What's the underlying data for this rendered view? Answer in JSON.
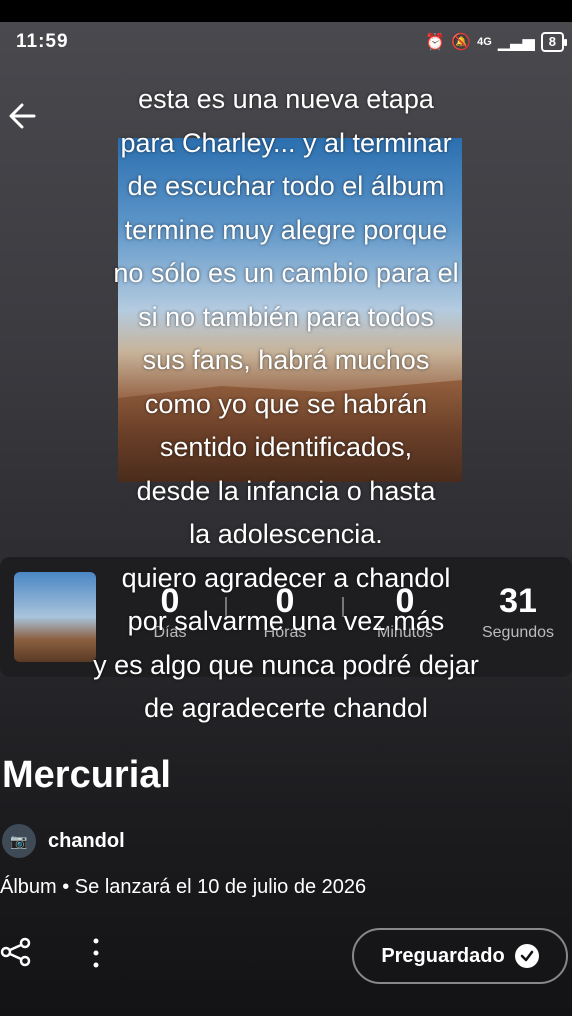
{
  "status": {
    "time": "11:59",
    "network": "4G",
    "battery": "8"
  },
  "overlay_lines": [
    "esta es una nueva etapa",
    "para Charley... y al terminar",
    "de escuchar todo el álbum",
    "termine muy alegre porque",
    "no sólo es un cambio para el",
    "si no también para todos",
    "sus fans, habrá muchos",
    "como yo que se habrán",
    "sentido identificados,",
    "desde la infancia o hasta",
    "la adolescencia.",
    "quiero agradecer a chandol",
    "por salvarme una vez más",
    "y es algo que nunca podré dejar",
    "de agradecerte chandol"
  ],
  "countdown": {
    "days": {
      "value": "0",
      "label": "Días"
    },
    "hours": {
      "value": "0",
      "label": "Horas"
    },
    "minutes": {
      "value": "0",
      "label": "Minutos"
    },
    "seconds": {
      "value": "31",
      "label": "Segundos"
    }
  },
  "album": {
    "title": "Mercurial",
    "artist": "chandol",
    "meta": "Álbum • Se lanzará el 10 de julio de 2026"
  },
  "actions": {
    "presave_label": "Preguardado"
  }
}
